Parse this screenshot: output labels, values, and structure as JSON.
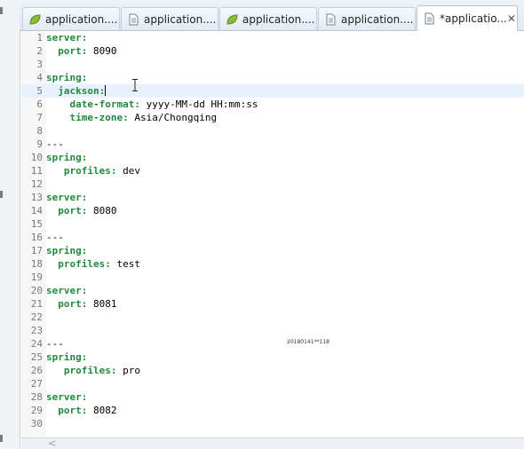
{
  "tabs": [
    {
      "label": "application....",
      "icon": "spring-leaf-icon",
      "active": false,
      "dirty": false
    },
    {
      "label": "application....",
      "icon": "text-file-icon",
      "active": false,
      "dirty": false
    },
    {
      "label": "application....",
      "icon": "spring-leaf-icon",
      "active": false,
      "dirty": false
    },
    {
      "label": "application....",
      "icon": "text-file-icon",
      "active": false,
      "dirty": false
    },
    {
      "label": "*applicatio...",
      "icon": "text-file-icon",
      "active": true,
      "dirty": true,
      "close": "✕"
    }
  ],
  "editor": {
    "current_line": 5,
    "lines": [
      {
        "n": "1",
        "indent": "",
        "key": "server",
        "sep": ":",
        "value": ""
      },
      {
        "n": "2",
        "indent": "  ",
        "key": "port",
        "sep": ":",
        "value": " 8090"
      },
      {
        "n": "3",
        "indent": "",
        "key": "",
        "sep": "",
        "value": ""
      },
      {
        "n": "4",
        "indent": "",
        "key": "spring",
        "sep": ":",
        "value": ""
      },
      {
        "n": "5",
        "indent": "  ",
        "key": "jackson",
        "sep": ":",
        "value": ""
      },
      {
        "n": "6",
        "indent": "    ",
        "key": "date-format",
        "sep": ":",
        "value": " yyyy-MM-dd HH:mm:ss"
      },
      {
        "n": "7",
        "indent": "    ",
        "key": "time-zone",
        "sep": ":",
        "value": " Asia/Chongqing"
      },
      {
        "n": "8",
        "indent": "",
        "key": "",
        "sep": "",
        "value": ""
      },
      {
        "n": "9",
        "indent": "",
        "key": "",
        "sep": "",
        "value": "---"
      },
      {
        "n": "10",
        "indent": "",
        "key": "spring",
        "sep": ":",
        "value": ""
      },
      {
        "n": "11",
        "indent": "   ",
        "key": "profiles",
        "sep": ":",
        "value": " dev"
      },
      {
        "n": "12",
        "indent": "",
        "key": "",
        "sep": "",
        "value": ""
      },
      {
        "n": "13",
        "indent": "",
        "key": "server",
        "sep": ":",
        "value": ""
      },
      {
        "n": "14",
        "indent": "  ",
        "key": "port",
        "sep": ":",
        "value": " 8080"
      },
      {
        "n": "15",
        "indent": "",
        "key": "",
        "sep": "",
        "value": ""
      },
      {
        "n": "16",
        "indent": "",
        "key": "",
        "sep": "",
        "value": "---"
      },
      {
        "n": "17",
        "indent": "",
        "key": "spring",
        "sep": ":",
        "value": ""
      },
      {
        "n": "18",
        "indent": "  ",
        "key": "profiles",
        "sep": ":",
        "value": " test"
      },
      {
        "n": "19",
        "indent": "",
        "key": "",
        "sep": "",
        "value": ""
      },
      {
        "n": "20",
        "indent": "",
        "key": "server",
        "sep": ":",
        "value": ""
      },
      {
        "n": "21",
        "indent": "  ",
        "key": "port",
        "sep": ":",
        "value": " 8081"
      },
      {
        "n": "22",
        "indent": "",
        "key": "",
        "sep": "",
        "value": ""
      },
      {
        "n": "23",
        "indent": "",
        "key": "",
        "sep": "",
        "value": ""
      },
      {
        "n": "24",
        "indent": "",
        "key": "",
        "sep": "",
        "value": "---"
      },
      {
        "n": "25",
        "indent": "",
        "key": "spring",
        "sep": ":",
        "value": ""
      },
      {
        "n": "26",
        "indent": "   ",
        "key": "profiles",
        "sep": ":",
        "value": " pro"
      },
      {
        "n": "27",
        "indent": "",
        "key": "",
        "sep": "",
        "value": ""
      },
      {
        "n": "28",
        "indent": "",
        "key": "server",
        "sep": ":",
        "value": ""
      },
      {
        "n": "29",
        "indent": "  ",
        "key": "port",
        "sep": ":",
        "value": " 8082"
      },
      {
        "n": "30",
        "indent": "",
        "key": "",
        "sep": "",
        "value": ""
      }
    ],
    "note": "20180141**118"
  },
  "scrollbar": {
    "left_arrow": "<"
  },
  "colors": {
    "key": "#1e8a3c",
    "current_line": "#e8f2fe",
    "line_number": "#787878"
  }
}
